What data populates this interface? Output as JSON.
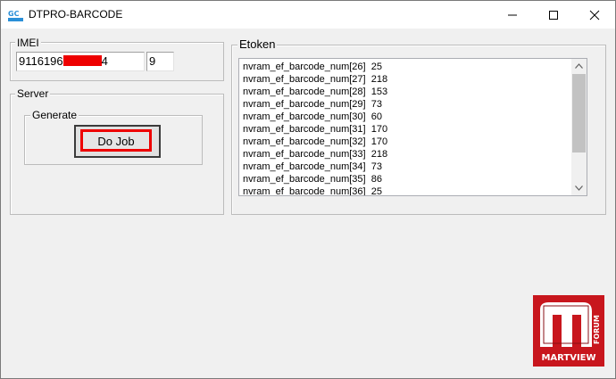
{
  "window": {
    "title": "DTPRO-BARCODE",
    "app_icon": "gc-app-icon",
    "controls": [
      "minimize-icon",
      "maximize-icon",
      "close-icon"
    ]
  },
  "imei": {
    "label": "IMEI",
    "value_prefix": "9116196",
    "value_suffix": "4",
    "check_digit": "9"
  },
  "server": {
    "label": "Server",
    "generate_label": "Generate",
    "do_job_label": "Do Job"
  },
  "etoken": {
    "label": "Etoken",
    "items": [
      {
        "name": "nvram_ef_barcode_num[26]",
        "value": "25"
      },
      {
        "name": "nvram_ef_barcode_num[27]",
        "value": "218"
      },
      {
        "name": "nvram_ef_barcode_num[28]",
        "value": "153"
      },
      {
        "name": "nvram_ef_barcode_num[29]",
        "value": "73"
      },
      {
        "name": "nvram_ef_barcode_num[30]",
        "value": "60"
      },
      {
        "name": "nvram_ef_barcode_num[31]",
        "value": "170"
      },
      {
        "name": "nvram_ef_barcode_num[32]",
        "value": "170"
      },
      {
        "name": "nvram_ef_barcode_num[33]",
        "value": "218"
      },
      {
        "name": "nvram_ef_barcode_num[34]",
        "value": "73"
      },
      {
        "name": "nvram_ef_barcode_num[35]",
        "value": "86"
      },
      {
        "name": "nvram_ef_barcode_num[36]",
        "value": "25"
      }
    ]
  },
  "watermark": {
    "brand": "MARTVIEW",
    "sub": "FORUM",
    "color": "#c8161d"
  },
  "colors": {
    "redaction": "#ee0000",
    "window_bg": "#f0f0f0"
  }
}
